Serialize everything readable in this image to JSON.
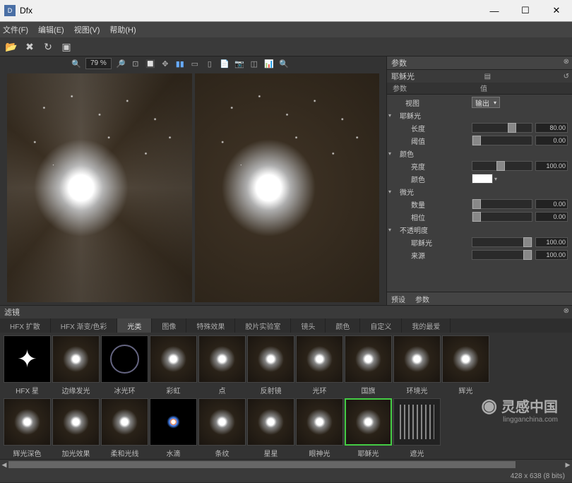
{
  "app": {
    "title": "Dfx"
  },
  "menu": {
    "file": "文件(F)",
    "edit": "编辑(E)",
    "view": "视图(V)",
    "help": "帮助(H)"
  },
  "viewport": {
    "zoom": "79 %"
  },
  "panel": {
    "title": "参数",
    "subtitle": "耶稣光",
    "col_param": "参数",
    "col_value": "值",
    "footer_preset": "预设",
    "footer_params": "参数",
    "view_label": "视图",
    "view_value": "输出",
    "groups": {
      "yslight": {
        "label": "耶稣光",
        "length": {
          "label": "长度",
          "value": "80.00"
        },
        "threshold": {
          "label": "阈值",
          "value": "0.00"
        }
      },
      "color": {
        "label": "颜色",
        "brightness": {
          "label": "亮度",
          "value": "100.00"
        },
        "color": {
          "label": "颜色"
        }
      },
      "shimmer": {
        "label": "微光",
        "amount": {
          "label": "数量",
          "value": "0.00"
        },
        "phase": {
          "label": "相位",
          "value": "0.00"
        }
      },
      "opacity": {
        "label": "不透明度",
        "yslight": {
          "label": "耶稣光",
          "value": "100.00"
        },
        "source": {
          "label": "来源",
          "value": "100.00"
        }
      }
    }
  },
  "filters": {
    "title": "滤镜",
    "tabs": [
      "HFX 扩散",
      "HFX 渐变/色彩",
      "光类",
      "图像",
      "特殊效果",
      "胶片实验室",
      "镜头",
      "颜色",
      "自定义",
      "我的最爱"
    ],
    "active_tab": 2,
    "row1": [
      "HFX 星",
      "边缘发光",
      "冰光环",
      "彩虹",
      "点",
      "反射镜",
      "光环",
      "国旗",
      "环境光",
      "辉光"
    ],
    "row2": [
      "辉光深色",
      "加光效果",
      "柔和光线",
      "水滴",
      "条纹",
      "星星",
      "眼神光",
      "耶稣光",
      "遮光",
      ""
    ],
    "selected": "耶稣光"
  },
  "status": {
    "dims": "428 x 638 (8 bits)"
  },
  "watermark": {
    "text": "灵感中国",
    "sub": "lingganchina.com"
  }
}
